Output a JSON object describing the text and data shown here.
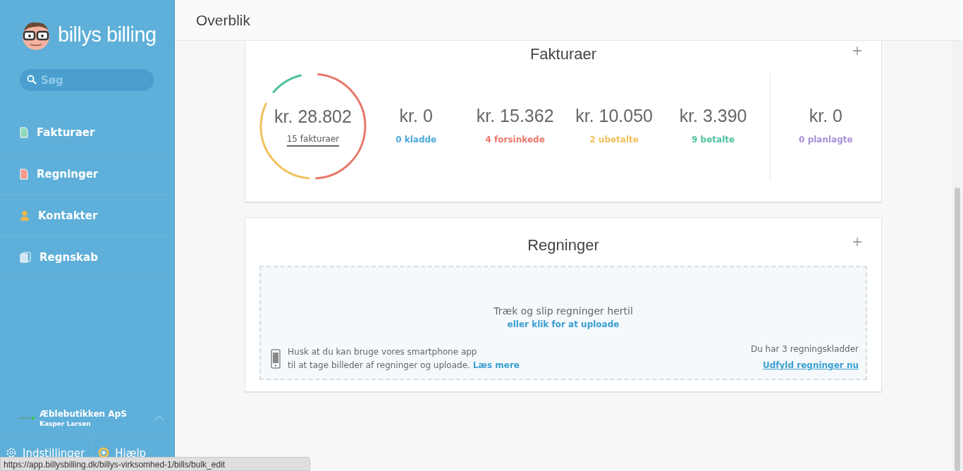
{
  "brand": {
    "name": "billys billing"
  },
  "search": {
    "placeholder": "Søg"
  },
  "nav": [
    {
      "label": "Fakturaer",
      "kind": "invoice"
    },
    {
      "label": "Regninger",
      "kind": "bill"
    },
    {
      "label": "Kontakter",
      "kind": "contact"
    },
    {
      "label": "Regnskab",
      "kind": "accounting"
    }
  ],
  "company": {
    "name": "Æblebutikken ApS",
    "user": "Kasper Larsen"
  },
  "footer_links": [
    {
      "label": "Indstillinger",
      "kind": "settings"
    },
    {
      "label": "Hjælp",
      "kind": "help"
    }
  ],
  "header": {
    "title": "Overblik"
  },
  "invoices": {
    "title": "Fakturaer",
    "total": "kr. 28.802",
    "count_link": "15 fakturaer",
    "stats": [
      {
        "amount": "kr. 0",
        "label": "0 kladde",
        "color": "#4aa8d8",
        "divider_before": false
      },
      {
        "amount": "kr. 15.362",
        "label": "4 forsinkede",
        "color": "#e8786a",
        "divider_before": false
      },
      {
        "amount": "kr. 10.050",
        "label": "2 ubetalte",
        "color": "#f0c15c",
        "divider_before": false
      },
      {
        "amount": "kr. 3.390",
        "label": "9 betalte",
        "color": "#4fc1a0",
        "divider_before": false
      },
      {
        "amount": "kr. 0",
        "label": "0 planlagte",
        "color": "#a98fd6",
        "divider_before": true
      }
    ]
  },
  "bills": {
    "title": "Regninger",
    "drop_text": "Træk og slip regninger hertil",
    "upload_link": "eller klik for at uploade",
    "app_line_1": "Husk at du kan bruge vores smartphone app",
    "app_line_2": "til at tage billeder af regninger og uploade.",
    "read_more": "Læs mere",
    "drafts_text": "Du har 3 regningskladder",
    "drafts_link": "Udfyld regninger nu"
  },
  "status_url": "https://app.billysbilling.dk/billys-virksomhed-1/bills/bulk_edit"
}
